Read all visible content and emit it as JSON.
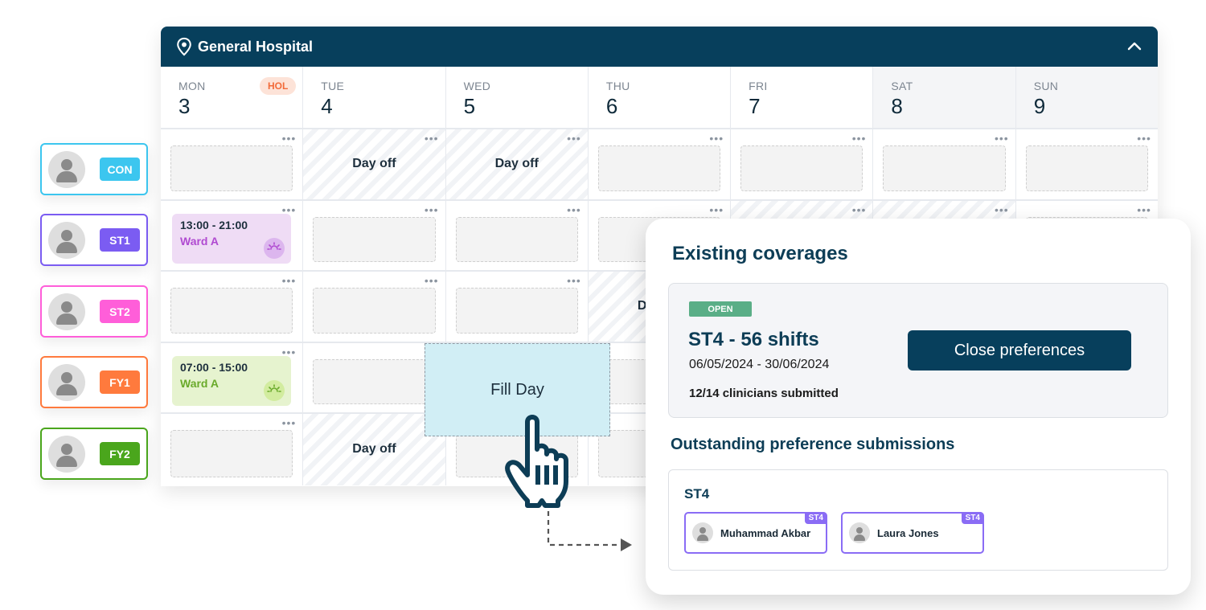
{
  "calendar": {
    "location_icon": "map-pin-icon",
    "title": "General Hospital",
    "collapse_icon": "chevron-up-icon",
    "days": [
      {
        "name": "MON",
        "num": "3",
        "badge": "HOL",
        "weekend": false
      },
      {
        "name": "TUE",
        "num": "4",
        "badge": null,
        "weekend": false
      },
      {
        "name": "WED",
        "num": "5",
        "badge": null,
        "weekend": false
      },
      {
        "name": "THU",
        "num": "6",
        "badge": null,
        "weekend": false
      },
      {
        "name": "FRI",
        "num": "7",
        "badge": null,
        "weekend": false
      },
      {
        "name": "SAT",
        "num": "8",
        "badge": null,
        "weekend": true
      },
      {
        "name": "SUN",
        "num": "9",
        "badge": null,
        "weekend": true
      }
    ],
    "more_glyph": "•••",
    "rows": [
      {
        "role": "CON",
        "color": "#3cc6ef",
        "cells": [
          {
            "type": "empty"
          },
          {
            "type": "dayoff",
            "label": "Day off"
          },
          {
            "type": "dayoff",
            "label": "Day off"
          },
          {
            "type": "empty"
          },
          {
            "type": "empty"
          },
          {
            "type": "empty"
          },
          {
            "type": "empty"
          }
        ]
      },
      {
        "role": "ST1",
        "color": "#7b5cf2",
        "cells": [
          {
            "type": "shift",
            "time": "13:00 - 21:00",
            "ward": "Ward A",
            "bg": "#efdcf5",
            "ward_color": "#b04ad1",
            "icon_bg": "#dcb6ee",
            "icon": "sunset-icon"
          },
          {
            "type": "empty"
          },
          {
            "type": "empty"
          },
          {
            "type": "empty"
          },
          {
            "type": "dayoff"
          },
          {
            "type": "dayoff"
          },
          {
            "type": "empty"
          }
        ]
      },
      {
        "role": "ST2",
        "color": "#ff5ed9",
        "cells": [
          {
            "type": "empty"
          },
          {
            "type": "empty"
          },
          {
            "type": "empty"
          },
          {
            "type": "dayoff",
            "label": "Day off"
          },
          {
            "type": "empty"
          },
          {
            "type": "empty"
          },
          {
            "type": "empty"
          }
        ]
      },
      {
        "role": "FY1",
        "color": "#ff7a3d",
        "cells": [
          {
            "type": "shift",
            "time": "07:00 - 15:00",
            "ward": "Ward A",
            "bg": "#e6f3cf",
            "ward_color": "#6aaa2b",
            "icon_bg": "#d2ec9f",
            "icon": "sunrise-icon"
          },
          {
            "type": "empty"
          },
          {
            "type": "empty"
          },
          {
            "type": "empty"
          },
          {
            "type": "empty"
          },
          {
            "type": "empty"
          },
          {
            "type": "empty"
          }
        ]
      },
      {
        "role": "FY2",
        "color": "#4aa61c",
        "cells": [
          {
            "type": "empty"
          },
          {
            "type": "dayoff",
            "label": "Day off"
          },
          {
            "type": "empty"
          },
          {
            "type": "empty"
          },
          {
            "type": "empty"
          },
          {
            "type": "empty"
          },
          {
            "type": "empty"
          }
        ]
      }
    ],
    "fill_day_label": "Fill Day"
  },
  "panel": {
    "title": "Existing coverages",
    "coverage": {
      "status": "OPEN",
      "status_color": "#5aae87",
      "title": "ST4 - 56 shifts",
      "dates": "06/05/2024 - 30/06/2024",
      "submitted": "12/14 clinicians submitted",
      "close_button": "Close preferences"
    },
    "outstanding_title": "Outstanding preference submissions",
    "outstanding": {
      "group": "ST4",
      "people": [
        {
          "name": "Muhammad Akbar",
          "tag": "ST4"
        },
        {
          "name": "Laura Jones",
          "tag": "ST4"
        }
      ]
    }
  },
  "colors": {
    "brand_navy": "#073f5c",
    "heading_navy": "#0d3d56",
    "fill_day_bg": "#d1eef5",
    "st4_purple": "#8a6cf5",
    "hol_bg": "#fde3d8",
    "hol_text": "#f26b3a"
  }
}
